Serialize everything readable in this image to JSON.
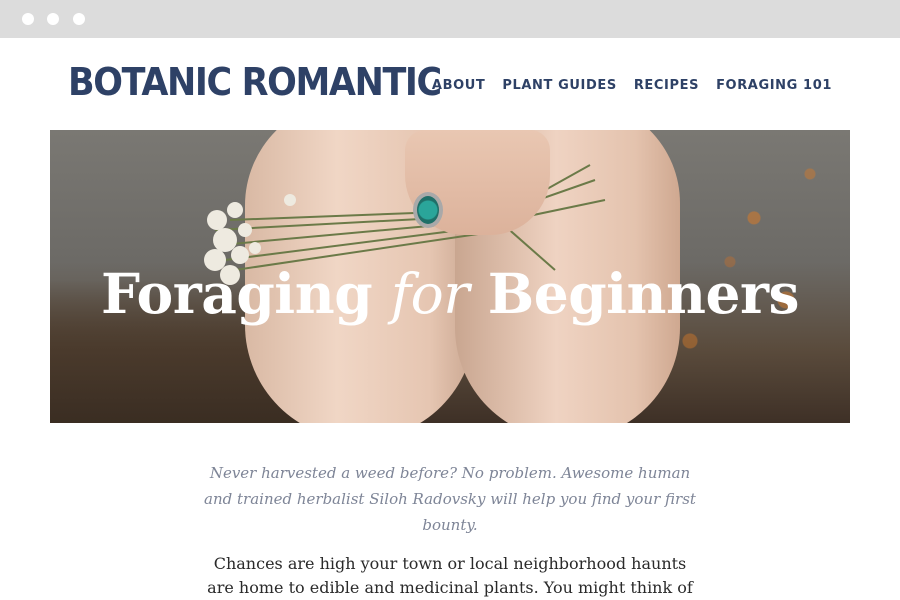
{
  "browser": {
    "window_dots": [
      "dot",
      "dot",
      "dot"
    ]
  },
  "header": {
    "logo": "BOTANIC ROMANTIC",
    "nav": [
      {
        "label": "ABOUT"
      },
      {
        "label": "PLANT GUIDES"
      },
      {
        "label": "RECIPES"
      },
      {
        "label": "FORAGING 101"
      }
    ]
  },
  "hero": {
    "title_part1": "Foraging ",
    "title_part2": "for",
    "title_part3": " Beginners"
  },
  "article": {
    "intro": "Never harvested a weed before? No problem. Awesome human and trained herbalist Siloh Radovsky will help you find your first bounty.",
    "body": "Chances are high your town or local neighborhood haunts are home to edible and medicinal plants. You might think of some"
  },
  "colors": {
    "brand": "#2e4166",
    "intro_text": "#7e8597",
    "body_text": "#2a2a2a",
    "browser_bar": "#dcdcdc"
  }
}
